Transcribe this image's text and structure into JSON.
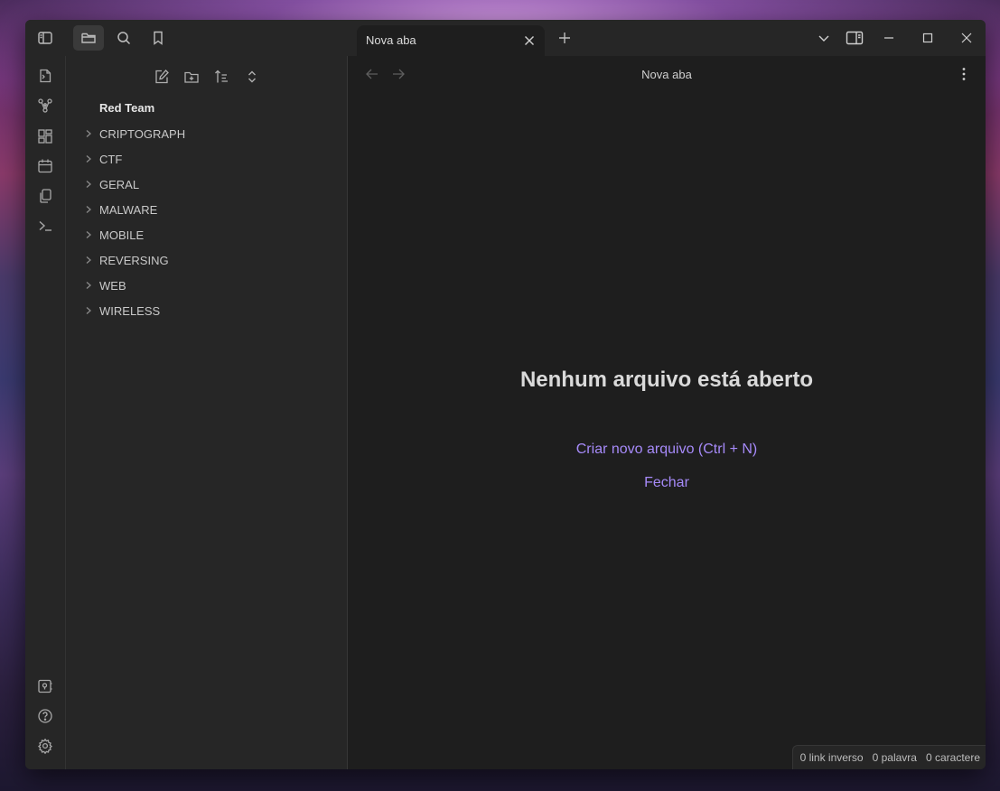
{
  "titlebar": {
    "toolbar_icons": [
      "sidebar-toggle-icon",
      "folder-icon",
      "search-icon",
      "bookmark-icon"
    ],
    "tab": {
      "title": "Nova aba"
    },
    "window_controls": [
      "chevron-down-icon",
      "split-view-icon",
      "minimize-icon",
      "maximize-icon",
      "close-icon"
    ]
  },
  "ribbon": {
    "top": [
      "open-quick-switcher-icon",
      "graph-view-icon",
      "canvas-icon",
      "daily-notes-icon",
      "templates-icon",
      "command-palette-icon"
    ],
    "bottom": [
      "vault-switcher-icon",
      "help-icon",
      "settings-icon"
    ]
  },
  "sidebar": {
    "tools": [
      "new-note-icon",
      "new-folder-icon",
      "sort-icon",
      "collapse-all-icon"
    ],
    "vault_name": "Red Team",
    "folders": [
      {
        "name": "CRIPTOGRAPH"
      },
      {
        "name": "CTF"
      },
      {
        "name": "GERAL"
      },
      {
        "name": "MALWARE"
      },
      {
        "name": "MOBILE"
      },
      {
        "name": "REVERSING"
      },
      {
        "name": "WEB"
      },
      {
        "name": "WIRELESS"
      }
    ]
  },
  "main": {
    "view_title": "Nova aba",
    "empty_state": {
      "title": "Nenhum arquivo está aberto",
      "create_label": "Criar novo arquivo (Ctrl + N)",
      "close_label": "Fechar"
    }
  },
  "statusbar": {
    "backlinks": "0 link inverso",
    "words": "0 palavra",
    "characters": "0 caractere"
  },
  "colors": {
    "accent": "#a68af9",
    "background": "#1e1e1e",
    "panel": "#262626"
  }
}
